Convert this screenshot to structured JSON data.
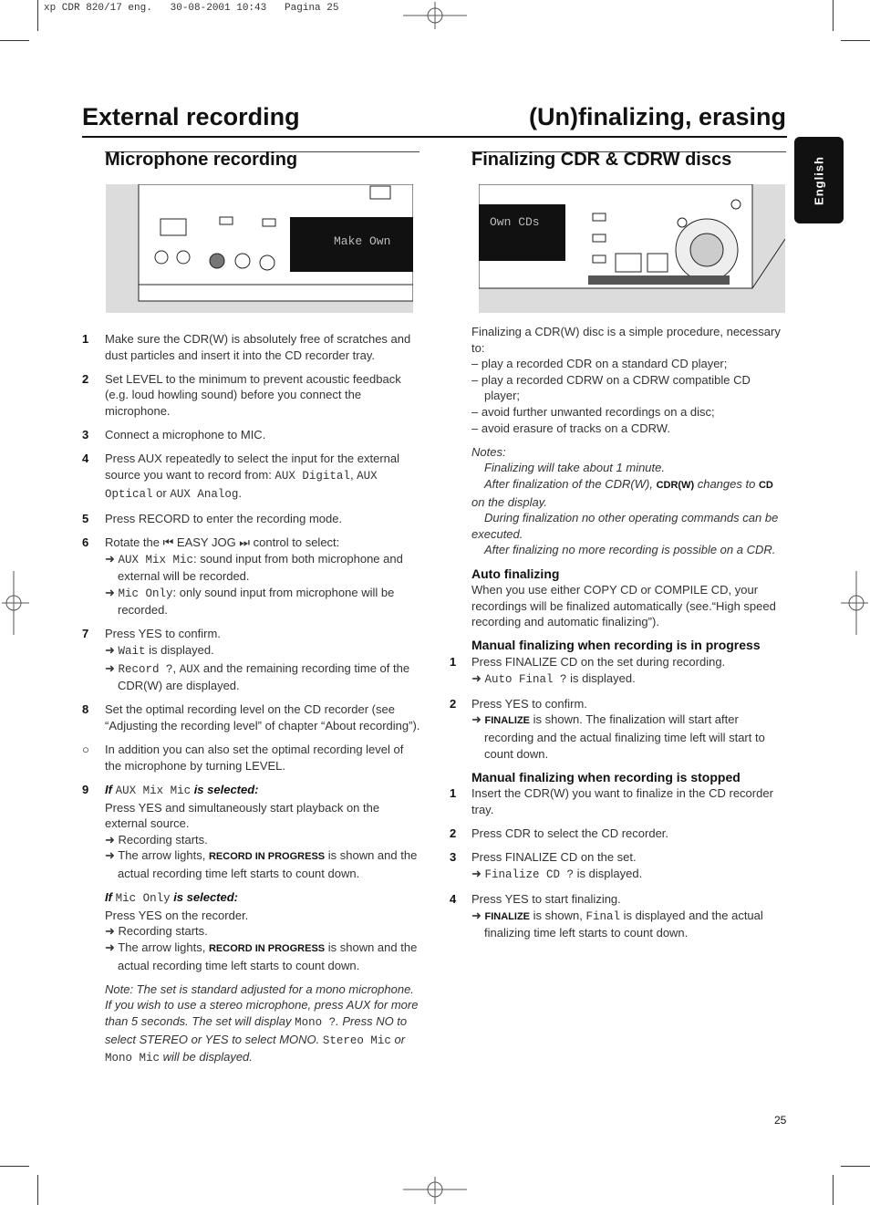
{
  "print_header": "xp CDR 820/17 eng.   30-08-2001 10:43   Pagina 25",
  "titles": {
    "left": "External recording",
    "right": "(Un)finalizing, erasing"
  },
  "sections": {
    "left": "Microphone recording",
    "right": "Finalizing CDR & CDRW discs"
  },
  "language_tab": "English",
  "page_number": "25",
  "illustrations": {
    "left_display_text": "Make Own",
    "right_display_text": "Own CDs"
  },
  "left": [
    {
      "num": "1",
      "paras": [
        {
          "k": "p",
          "s": [
            {
              "t": "Make sure the CDR(W) is absolutely free of scratches and dust particles and insert it into the CD recorder tray."
            }
          ]
        }
      ]
    },
    {
      "num": "2",
      "paras": [
        {
          "k": "p",
          "s": [
            {
              "t": "Set LEVEL to the minimum to prevent acoustic feedback (e.g. loud howling sound) before you connect the microphone."
            }
          ]
        }
      ]
    },
    {
      "num": "3",
      "paras": [
        {
          "k": "p",
          "s": [
            {
              "t": "Connect a microphone to MIC."
            }
          ]
        }
      ]
    },
    {
      "num": "4",
      "paras": [
        {
          "k": "p",
          "s": [
            {
              "t": "Press AUX repeatedly to select the input for the external source you want to record from: "
            },
            {
              "t": "AUX Digital",
              "c": "m"
            },
            {
              "t": ", "
            },
            {
              "t": "AUX Optical",
              "c": "m"
            },
            {
              "t": " or "
            },
            {
              "t": "AUX Analog",
              "c": "m"
            },
            {
              "t": "."
            }
          ]
        }
      ]
    },
    {
      "num": "5",
      "paras": [
        {
          "k": "p",
          "s": [
            {
              "t": "Press RECORD to enter the recording mode."
            }
          ]
        }
      ]
    },
    {
      "num": "6",
      "paras": [
        {
          "k": "p",
          "s": [
            {
              "t": "Rotate the ⏮ EASY JOG ⏭ control to select:"
            }
          ]
        },
        {
          "k": "arrow",
          "s": [
            {
              "t": "➜ "
            },
            {
              "t": "AUX Mix Mic",
              "c": "m"
            },
            {
              "t": ": sound input from both microphone and external will be recorded."
            }
          ]
        },
        {
          "k": "arrow",
          "s": [
            {
              "t": "➜ "
            },
            {
              "t": "Mic Only",
              "c": "m"
            },
            {
              "t": ": only sound input from microphone will be recorded."
            }
          ]
        }
      ]
    },
    {
      "num": "7",
      "paras": [
        {
          "k": "p",
          "s": [
            {
              "t": "Press YES to confirm."
            }
          ]
        },
        {
          "k": "arrow",
          "s": [
            {
              "t": "➜ "
            },
            {
              "t": "Wait",
              "c": "m"
            },
            {
              "t": " is displayed."
            }
          ]
        },
        {
          "k": "arrow",
          "s": [
            {
              "t": "➜ "
            },
            {
              "t": "Record ?",
              "c": "m"
            },
            {
              "t": ", "
            },
            {
              "t": "AUX",
              "c": "m"
            },
            {
              "t": " and the remaining recording time of the CDR(W) are displayed."
            }
          ]
        }
      ]
    },
    {
      "num": "8",
      "paras": [
        {
          "k": "p",
          "s": [
            {
              "t": "Set the optimal recording level on the CD recorder (see “Adjusting the recording level” of chapter “About recording”)."
            }
          ]
        }
      ]
    },
    {
      "num": "○",
      "paras": [
        {
          "k": "p",
          "s": [
            {
              "t": "In addition you can also set the optimal recording level of the microphone by turning LEVEL."
            }
          ]
        }
      ]
    },
    {
      "num": "9",
      "paras": [
        {
          "k": "p",
          "s": [
            {
              "t": "If ",
              "c": "bi"
            },
            {
              "t": "AUX Mix Mic",
              "c": "m"
            },
            {
              "t": " is selected:",
              "c": "bi"
            }
          ]
        },
        {
          "k": "p",
          "s": [
            {
              "t": "Press YES and simultaneously start playback on the external source."
            }
          ]
        },
        {
          "k": "arrow",
          "s": [
            {
              "t": "➜ Recording starts."
            }
          ]
        },
        {
          "k": "arrow",
          "s": [
            {
              "t": "➜ The arrow lights, "
            },
            {
              "t": "RECORD IN PROGRESS",
              "c": "b"
            },
            {
              "t": " is shown and the actual recording time left starts to count down."
            }
          ]
        }
      ]
    },
    {
      "num": "",
      "paras": [
        {
          "k": "p",
          "s": [
            {
              "t": "If ",
              "c": "bi"
            },
            {
              "t": "Mic Only",
              "c": "m"
            },
            {
              "t": " is selected:",
              "c": "bi"
            }
          ]
        },
        {
          "k": "p",
          "s": [
            {
              "t": "Press YES on the recorder."
            }
          ]
        },
        {
          "k": "arrow",
          "s": [
            {
              "t": "➜ Recording starts."
            }
          ]
        },
        {
          "k": "arrow",
          "s": [
            {
              "t": "➜ The arrow lights, "
            },
            {
              "t": "RECORD IN PROGRESS",
              "c": "b"
            },
            {
              "t": " is shown and the actual recording time left starts to count down."
            }
          ]
        }
      ]
    },
    {
      "num": "",
      "paras": [
        {
          "k": "p",
          "s": [
            {
              "t": "Note: The set is standard adjusted for a mono microphone. If you wish to use a stereo microphone, press AUX for more than 5 seconds. The set will display ",
              "c": "i"
            },
            {
              "t": "Mono ?",
              "c": "m"
            },
            {
              "t": ". Press NO to select STEREO or YES to select MONO. ",
              "c": "i"
            },
            {
              "t": "Stereo Mic",
              "c": "m"
            },
            {
              "t": " or ",
              "c": "i"
            },
            {
              "t": "Mono Mic",
              "c": "m"
            },
            {
              "t": " will be displayed.",
              "c": "i"
            }
          ]
        }
      ]
    }
  ],
  "right": [
    {
      "num": "",
      "paras": [
        {
          "k": "p",
          "s": [
            {
              "t": "Finalizing a CDR(W) disc is a simple procedure, necessary to:"
            }
          ]
        },
        {
          "k": "arrow",
          "s": [
            {
              "t": "– play a recorded CDR on a standard CD player;"
            }
          ]
        },
        {
          "k": "arrow",
          "s": [
            {
              "t": "– play a recorded CDRW on a CDRW compatible CD player;"
            }
          ]
        },
        {
          "k": "arrow",
          "s": [
            {
              "t": "– avoid further unwanted recordings on a disc;"
            }
          ]
        },
        {
          "k": "arrow",
          "s": [
            {
              "t": "– avoid erasure of tracks on a CDRW."
            }
          ]
        }
      ]
    },
    {
      "num": "",
      "paras": [
        {
          "k": "p",
          "s": [
            {
              "t": "Notes:",
              "c": "i"
            }
          ]
        },
        {
          "k": "ind",
          "s": [
            {
              "t": "Finalizing will take about 1 minute.",
              "c": "i"
            }
          ]
        },
        {
          "k": "ind",
          "s": [
            {
              "t": "After finalization of the CDR(W), ",
              "c": "i"
            },
            {
              "t": "CDR(W)",
              "c": "b"
            },
            {
              "t": " changes to ",
              "c": "i"
            },
            {
              "t": "CD",
              "c": "b"
            },
            {
              "t": " on the display.",
              "c": "i"
            }
          ]
        },
        {
          "k": "ind",
          "s": [
            {
              "t": "During finalization no other operating commands can be executed.",
              "c": "i"
            }
          ]
        },
        {
          "k": "ind",
          "s": [
            {
              "t": "After finalizing no more recording is possible on a CDR.",
              "c": "i"
            }
          ]
        }
      ]
    },
    {
      "num": "",
      "paras": [
        {
          "k": "p",
          "s": [
            {
              "t": "Auto finalizing",
              "c": "sh"
            }
          ]
        },
        {
          "k": "p",
          "s": [
            {
              "t": "When you use either COPY CD or COMPILE CD, your recordings will be finalized automatically (see.“High speed recording and automatic finalizing”)."
            }
          ]
        }
      ]
    },
    {
      "num": "",
      "tight": true,
      "paras": [
        {
          "k": "p",
          "s": [
            {
              "t": "Manual finalizing when recording is in progress",
              "c": "sh"
            }
          ]
        }
      ]
    },
    {
      "num": "1",
      "paras": [
        {
          "k": "p",
          "s": [
            {
              "t": "Press FINALIZE CD on the set during recording."
            }
          ]
        },
        {
          "k": "arrow",
          "s": [
            {
              "t": "➜ "
            },
            {
              "t": "Auto Final ?",
              "c": "m"
            },
            {
              "t": " is displayed."
            }
          ]
        }
      ]
    },
    {
      "num": "2",
      "paras": [
        {
          "k": "p",
          "s": [
            {
              "t": "Press YES to confirm."
            }
          ]
        },
        {
          "k": "arrow",
          "s": [
            {
              "t": "➜ "
            },
            {
              "t": "FINALIZE",
              "c": "b"
            },
            {
              "t": " is shown. The finalization will start after recording and the actual finalizing time left will start to count down."
            }
          ]
        }
      ]
    },
    {
      "num": "",
      "tight": true,
      "paras": [
        {
          "k": "p",
          "s": [
            {
              "t": "Manual finalizing when recording is stopped",
              "c": "sh"
            }
          ]
        }
      ]
    },
    {
      "num": "1",
      "paras": [
        {
          "k": "p",
          "s": [
            {
              "t": "Insert the CDR(W) you want to finalize in the CD recorder tray."
            }
          ]
        }
      ]
    },
    {
      "num": "2",
      "paras": [
        {
          "k": "p",
          "s": [
            {
              "t": "Press CDR to select the CD recorder."
            }
          ]
        }
      ]
    },
    {
      "num": "3",
      "paras": [
        {
          "k": "p",
          "s": [
            {
              "t": "Press FINALIZE CD on the set."
            }
          ]
        },
        {
          "k": "arrow",
          "s": [
            {
              "t": "➜ "
            },
            {
              "t": "Finalize CD ?",
              "c": "m"
            },
            {
              "t": " is displayed."
            }
          ]
        }
      ]
    },
    {
      "num": "4",
      "paras": [
        {
          "k": "p",
          "s": [
            {
              "t": "Press YES to start finalizing."
            }
          ]
        },
        {
          "k": "arrow",
          "s": [
            {
              "t": "➜ "
            },
            {
              "t": "FINALIZE",
              "c": "b"
            },
            {
              "t": " is shown, "
            },
            {
              "t": "Final",
              "c": "m"
            },
            {
              "t": " is displayed and the actual finalizing time left starts to count down."
            }
          ]
        }
      ]
    }
  ]
}
